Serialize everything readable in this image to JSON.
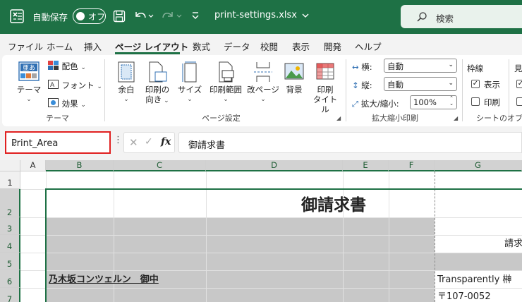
{
  "titlebar": {
    "autosave_label": "自動保存",
    "autosave_state": "オフ",
    "filename": "print-settings.xlsx",
    "search_placeholder": "検索",
    "bg_color": "#1e7145"
  },
  "tabs": [
    {
      "label": "ファイル"
    },
    {
      "label": "ホーム"
    },
    {
      "label": "挿入"
    },
    {
      "label": "ページ レイアウト",
      "active": true
    },
    {
      "label": "数式"
    },
    {
      "label": "データ"
    },
    {
      "label": "校閲"
    },
    {
      "label": "表示"
    },
    {
      "label": "開発"
    },
    {
      "label": "ヘルプ"
    }
  ],
  "ribbon": {
    "theme": {
      "themes": "テーマ",
      "colors": "配色",
      "fonts": "フォント",
      "effects": "効果",
      "group": "テーマ"
    },
    "page_setup": {
      "margins": "余白",
      "orientation_1": "印刷の",
      "orientation_2": "向き",
      "size": "サイズ",
      "print_area": "印刷範囲",
      "breaks": "改ページ",
      "background": "背景",
      "print_titles_1": "印刷",
      "print_titles_2": "タイトル",
      "group": "ページ設定"
    },
    "scale": {
      "width_label": "横:",
      "width_value": "自動",
      "height_label": "縦:",
      "height_value": "自動",
      "scale_label": "拡大/縮小:",
      "scale_value": "100%",
      "group": "拡大縮小印刷"
    },
    "sheet_options": {
      "gridlines": "枠線",
      "view": "表示",
      "print": "印刷",
      "headings_partial": "見",
      "group": "シートのオプシ"
    }
  },
  "formula_bar": {
    "name_box": "Print_Area",
    "formula": "御請求書",
    "fx": "fx"
  },
  "grid": {
    "columns": [
      "A",
      "B",
      "C",
      "D",
      "E",
      "F",
      "G"
    ],
    "rows": [
      "1",
      "2",
      "3",
      "4",
      "5",
      "6",
      "7"
    ],
    "cells": {
      "D2": "御請求書",
      "G4_partial": "請求",
      "B6": "乃木坂コンツェルン　御中",
      "G6": "Transparently 榊",
      "G7": "〒107-0052"
    }
  }
}
